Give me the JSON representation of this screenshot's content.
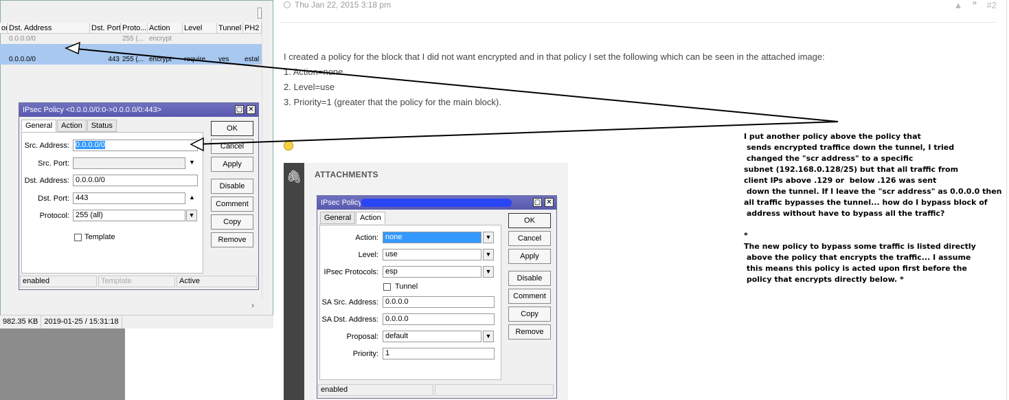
{
  "forum": {
    "timestamp": "Thu Jan 22, 2015 3:18 pm",
    "post_number": "#2",
    "post_lines": [
      "I created a policy for the block that I did not want encrypted and in that policy I set the following which can be seen in the attached image:",
      "1. Action=none",
      "2. Level=use",
      "3. Priority=1 (greater that the policy for the main block)."
    ],
    "attachments_title": "ATTACHMENTS",
    "note": "I put another policy above the policy that\n sends encrypted traffice down the tunnel, I tried\n changed the \"scr address\" to a specific\nsubnet (192.168.0.128/25) but that all traffic from\nclient IPs above .129 or  below .126 was sent\n down the tunnel. If I leave the \"scr address\" as 0.0.0.0 then\nall traffic bypasses the tunnel... how do I bypass block of\n address without have to bypass all the traffic?\n\n*\nThe new policy to bypass some traffic is listed directly\n above the policy that encrypts the traffic... I assume\n this means this policy is acted upon first before the\n policy that encrypts directly below. *"
  },
  "table": {
    "headers": [
      "ort",
      "Dst. Address",
      "Dst. Port",
      "Proto...",
      "Action",
      "Level",
      "Tunnel",
      "PH2"
    ],
    "rows": [
      [
        "",
        "0.0.0.0/0",
        "",
        "255 (...",
        "encrypt",
        "",
        "",
        ""
      ],
      [
        "",
        "",
        "",
        "",
        "",
        "",
        "",
        ""
      ],
      [
        "",
        "0.0.0.0/0",
        "443",
        "255 (...",
        "encrypt",
        "require",
        "yes",
        "estal"
      ]
    ],
    "status": [
      "982.35 KB",
      "2019-01-25 / 15:31:18"
    ]
  },
  "dialog1": {
    "title": "IPsec Policy <0.0.0.0/0:0->0.0.0.0/0:443>",
    "tabs": [
      "General",
      "Action",
      "Status"
    ],
    "fields": {
      "src_address_label": "Src. Address:",
      "src_address": "0.0.0.0/0",
      "src_port_label": "Src. Port:",
      "dst_address_label": "Dst. Address:",
      "dst_address": "0.0.0.0/0",
      "dst_port_label": "Dst. Port:",
      "dst_port": "443",
      "protocol_label": "Protocol:",
      "protocol": "255 (all)",
      "template_label": "Template"
    },
    "buttons": [
      "OK",
      "Cancel",
      "Apply",
      "Disable",
      "Comment",
      "Copy",
      "Remove"
    ],
    "status": [
      "enabled",
      "Template",
      "Active"
    ]
  },
  "dialog2": {
    "title": "IPsec Policy",
    "tabs": [
      "General",
      "Action"
    ],
    "fields": {
      "action_label": "Action:",
      "action": "none",
      "level_label": "Level:",
      "level": "use",
      "protocols_label": "IPsec Protocols:",
      "protocols": "esp",
      "tunnel_label": "Tunnel",
      "sa_src_label": "SA Src. Address:",
      "sa_src": "0.0.0.0",
      "sa_dst_label": "SA Dst. Address:",
      "sa_dst": "0.0.0.0",
      "proposal_label": "Proposal:",
      "proposal": "default",
      "priority_label": "Priority:",
      "priority": "1"
    },
    "buttons": [
      "OK",
      "Cancel",
      "Apply",
      "Disable",
      "Comment",
      "Copy",
      "Remove"
    ],
    "status": [
      "enabled"
    ]
  }
}
